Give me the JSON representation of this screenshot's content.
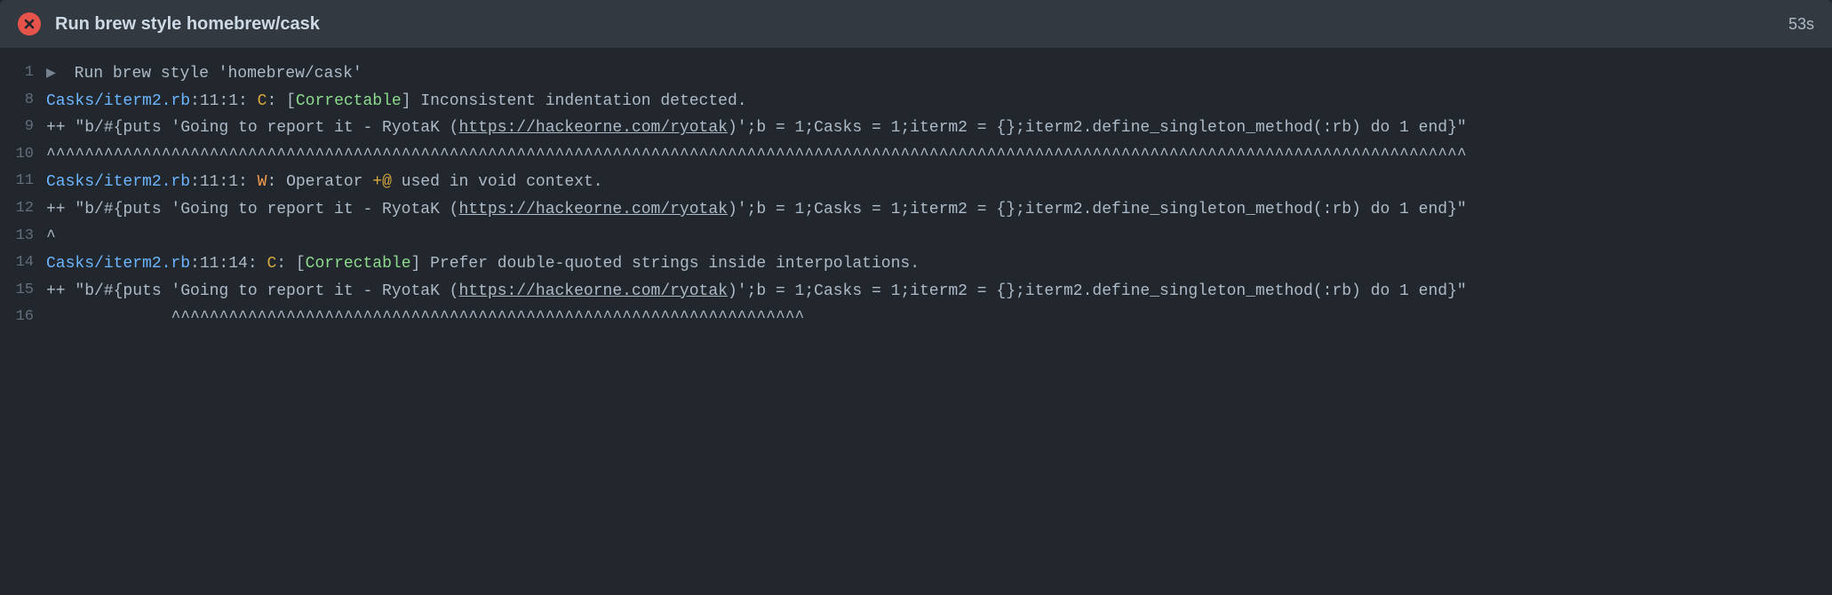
{
  "header": {
    "title": "Run brew style homebrew/cask",
    "duration": "53s",
    "status": "failed"
  },
  "lines": [
    {
      "num": "1",
      "segments": [
        {
          "text": "▶ ",
          "cls": "caret"
        },
        {
          "text": "Run brew style 'homebrew/cask'"
        }
      ]
    },
    {
      "num": "8",
      "segments": [
        {
          "text": "Casks/iterm2.rb",
          "cls": "cyan"
        },
        {
          "text": ":11:1: "
        },
        {
          "text": "C",
          "cls": "yellow"
        },
        {
          "text": ": ["
        },
        {
          "text": "Correctable",
          "cls": "green"
        },
        {
          "text": "] Inconsistent indentation detected."
        }
      ]
    },
    {
      "num": "9",
      "segments": [
        {
          "text": "++ \"b/#{puts 'Going to report it - RyotaK ("
        },
        {
          "text": "https://hackeorne.com/ryotak",
          "link": true
        },
        {
          "text": ")';b = 1;Casks = 1;iterm2 = {};iterm2.define_singleton_method(:rb) do 1 end}\""
        }
      ]
    },
    {
      "num": "10",
      "segments": [
        {
          "text": "^^^^^^^^^^^^^^^^^^^^^^^^^^^^^^^^^^^^^^^^^^^^^^^^^^^^^^^^^^^^^^^^^^^^^^^^^^^^^^^^^^^^^^^^^^^^^^^^^^^^^^^^^^^^^^^^^^^^^^^^^^^^^^^^^^^^^^^^^^^^^^^^^^^^"
        }
      ]
    },
    {
      "num": "11",
      "segments": [
        {
          "text": "Casks/iterm2.rb",
          "cls": "cyan"
        },
        {
          "text": ":11:1: "
        },
        {
          "text": "W",
          "cls": "orange"
        },
        {
          "text": ": Operator "
        },
        {
          "text": "+@",
          "cls": "yellow"
        },
        {
          "text": " used in void context."
        }
      ]
    },
    {
      "num": "12",
      "segments": [
        {
          "text": "++ \"b/#{puts 'Going to report it - RyotaK ("
        },
        {
          "text": "https://hackeorne.com/ryotak",
          "link": true
        },
        {
          "text": ")';b = 1;Casks = 1;iterm2 = {};iterm2.define_singleton_method(:rb) do 1 end}\""
        }
      ]
    },
    {
      "num": "13",
      "segments": [
        {
          "text": "^"
        }
      ]
    },
    {
      "num": "14",
      "segments": [
        {
          "text": "Casks/iterm2.rb",
          "cls": "cyan"
        },
        {
          "text": ":11:14: "
        },
        {
          "text": "C",
          "cls": "yellow"
        },
        {
          "text": ": ["
        },
        {
          "text": "Correctable",
          "cls": "green"
        },
        {
          "text": "] Prefer double-quoted strings inside interpolations."
        }
      ]
    },
    {
      "num": "15",
      "segments": [
        {
          "text": "++ \"b/#{puts 'Going to report it - RyotaK ("
        },
        {
          "text": "https://hackeorne.com/ryotak",
          "link": true
        },
        {
          "text": ")';b = 1;Casks = 1;iterm2 = {};iterm2.define_singleton_method(:rb) do 1 end}\""
        }
      ]
    },
    {
      "num": "16",
      "segments": [
        {
          "text": "             ^^^^^^^^^^^^^^^^^^^^^^^^^^^^^^^^^^^^^^^^^^^^^^^^^^^^^^^^^^^^^^^^^^"
        }
      ]
    }
  ]
}
